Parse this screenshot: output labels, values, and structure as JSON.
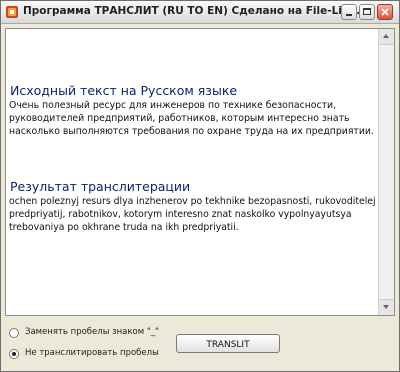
{
  "window": {
    "title": "Программа ТРАНСЛИТ (RU TO EN)  Сделано на File-Link.ru"
  },
  "source": {
    "heading": "Исходный текст на Русском языке",
    "text": "Очень полезный ресурс для инженеров по технике безопасности, руководителей предприятий, работников, которым интересно знать насколько выполняются требования по охране труда на их предприятии."
  },
  "result": {
    "heading": "Результат транслитерации",
    "text": "ochen poleznyj resurs dlya inzhenerov po tekhnike bezopasnosti, rukovoditelej predpriyatij, rabotnikov, kotorym interesno znat naskolko vypolnyayutsya trebovaniya po okhrane truda na ikh predpriyatii."
  },
  "options": {
    "replace_spaces": {
      "label": "Заменять пробелы знаком \"_\"",
      "checked": false
    },
    "no_translit_spaces": {
      "label": "Не транслитировать пробелы",
      "checked": true
    }
  },
  "translit_button": {
    "label": "TRANSLIT"
  },
  "colors": {
    "heading": "#0c1f6e",
    "window_bg": "#ece9d8"
  }
}
